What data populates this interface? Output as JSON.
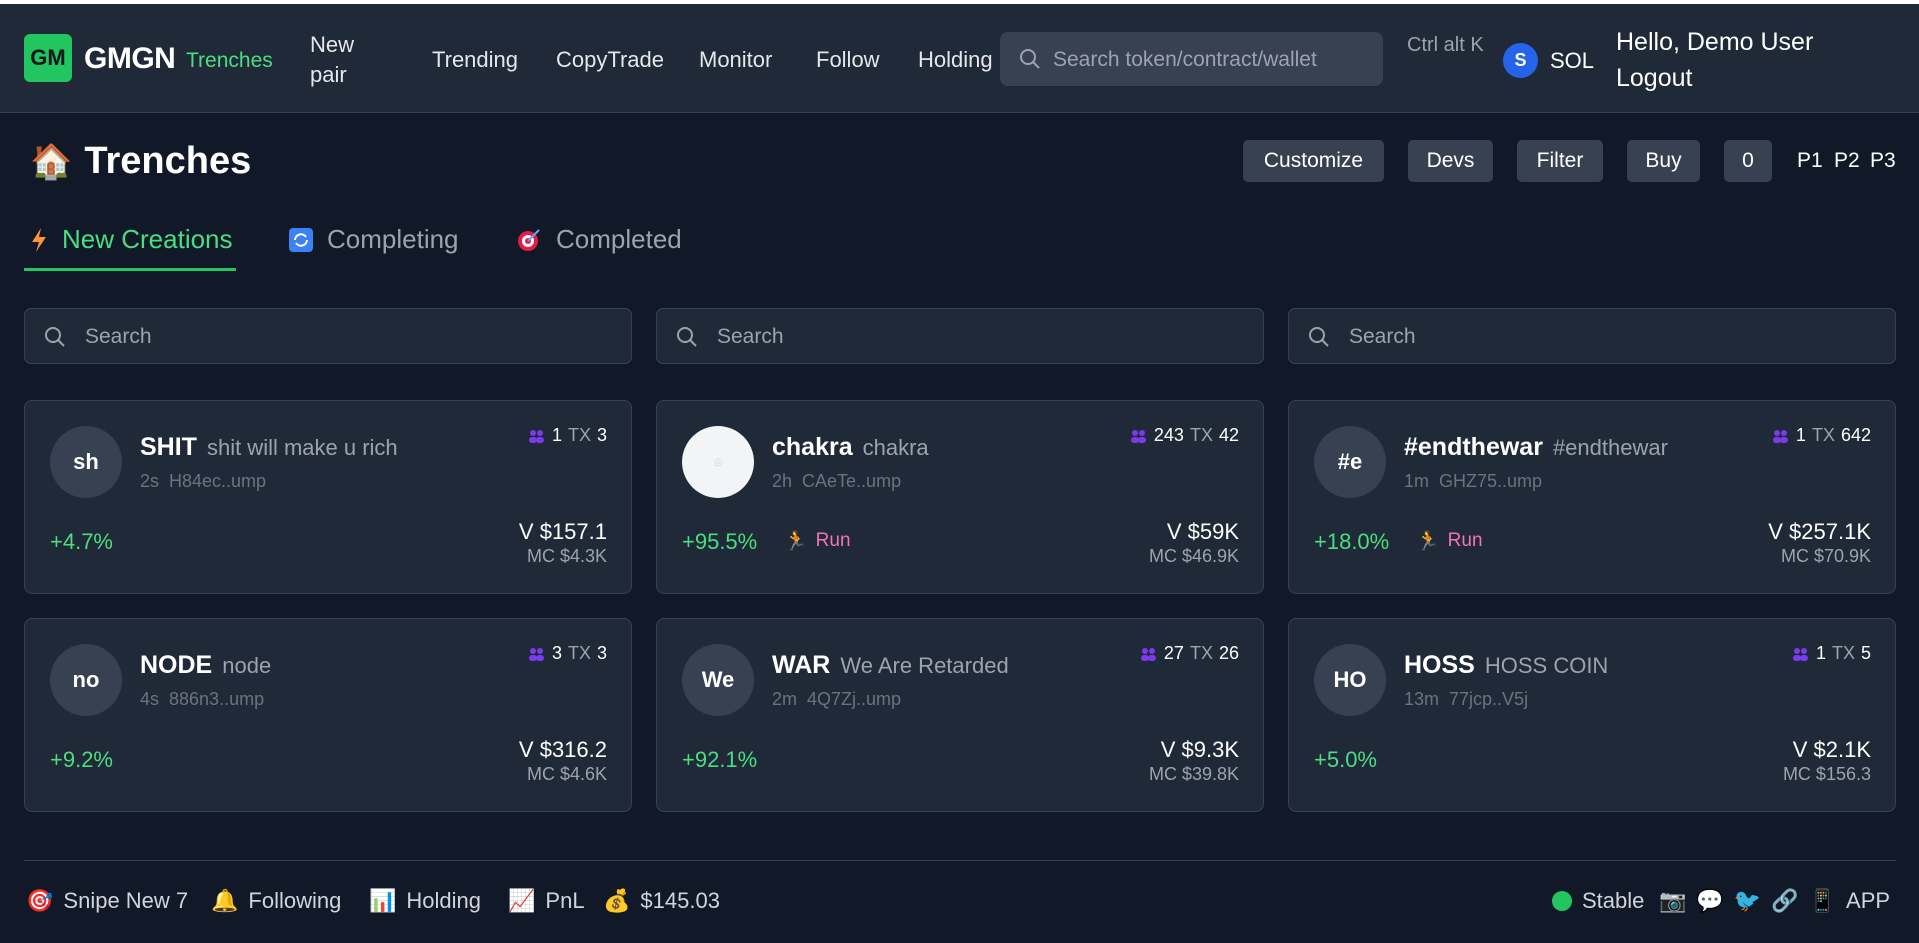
{
  "header": {
    "logo_badge": "GM",
    "logo_text": "GMGN",
    "logo_sub": "Trenches",
    "nav": [
      "New pair",
      "Trending",
      "CopyTrade",
      "Monitor",
      "Follow",
      "Holding"
    ],
    "search_placeholder": "Search token/contract/wallet",
    "shortcut": "Ctrl alt K",
    "chain_badge": "S",
    "chain_label": "SOL",
    "greeting": "Hello, Demo User",
    "logout": "Logout"
  },
  "page": {
    "title": "Trenches",
    "toolbar": [
      "Customize",
      "Devs",
      "Filter",
      "Buy",
      "0"
    ],
    "pages": [
      "P1",
      "P2",
      "P3"
    ]
  },
  "tabs": [
    {
      "label": "New Creations",
      "icon": "lightning-icon",
      "active": true
    },
    {
      "label": "Completing",
      "icon": "refresh-icon",
      "active": false
    },
    {
      "label": "Completed",
      "icon": "target-icon",
      "active": false
    }
  ],
  "column_search_placeholder": "Search",
  "cards": [
    {
      "avatar": "sh",
      "symbol": "SHIT",
      "name": "shit will make u rich",
      "age": "2s",
      "addr": "H84ec..ump",
      "holders": "1",
      "tx_label": "TX",
      "tx": "3",
      "change": "+4.7%",
      "run": "",
      "volume": "V $157.1",
      "mc": "MC $4.3K"
    },
    {
      "avatar": "",
      "symbol": "chakra",
      "name": "chakra",
      "age": "2h",
      "addr": "CAeTe..ump",
      "holders": "243",
      "tx_label": "TX",
      "tx": "42",
      "change": "+95.5%",
      "run": "Run",
      "volume": "V $59K",
      "mc": "MC $46.9K"
    },
    {
      "avatar": "#e",
      "symbol": "#endthewar",
      "name": "#endthewar",
      "age": "1m",
      "addr": "GHZ75..ump",
      "holders": "1",
      "tx_label": "TX",
      "tx": "642",
      "change": "+18.0%",
      "run": "Run",
      "volume": "V $257.1K",
      "mc": "MC $70.9K"
    },
    {
      "avatar": "no",
      "symbol": "NODE",
      "name": "node",
      "age": "4s",
      "addr": "886n3..ump",
      "holders": "3",
      "tx_label": "TX",
      "tx": "3",
      "change": "+9.2%",
      "run": "",
      "volume": "V $316.2",
      "mc": "MC $4.6K"
    },
    {
      "avatar": "We",
      "symbol": "WAR",
      "name": "We Are Retarded",
      "age": "2m",
      "addr": "4Q7Zj..ump",
      "holders": "27",
      "tx_label": "TX",
      "tx": "26",
      "change": "+92.1%",
      "run": "",
      "volume": "V $9.3K",
      "mc": "MC $39.8K"
    },
    {
      "avatar": "HO",
      "symbol": "HOSS",
      "name": "HOSS COIN",
      "age": "13m",
      "addr": "77jcp..V5j",
      "holders": "1",
      "tx_label": "TX",
      "tx": "5",
      "change": "+5.0%",
      "run": "",
      "volume": "V $2.1K",
      "mc": "MC $156.3"
    }
  ],
  "footer": {
    "snipe": "Snipe New 7",
    "following": "Following",
    "holding": "Holding",
    "pnl": "PnL",
    "balance": "$145.03",
    "status": "Stable",
    "app": "APP"
  },
  "colors": {
    "accent": "#22c55e",
    "background": "#111827",
    "panel": "#1f2937",
    "run": "#f472b6"
  }
}
